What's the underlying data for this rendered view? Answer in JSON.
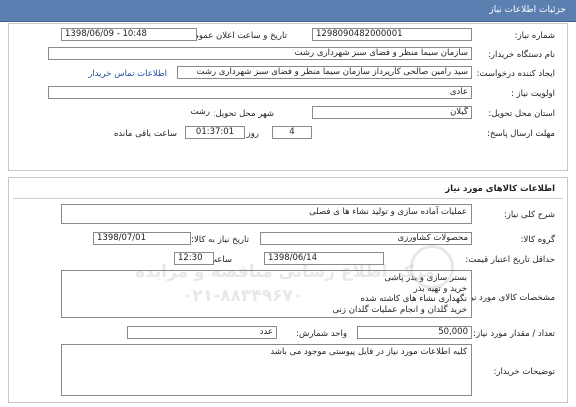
{
  "header": {
    "title": "جزئیات اطلاعات نیاز"
  },
  "info": {
    "need_number_label": "شماره نیاز:",
    "need_number": "1298090482000001",
    "announce_label": "تاریخ و ساعت اعلان عمومی:",
    "announce_value": "1398/06/09 - 10:48",
    "buyer_org_label": "نام دستگاه خریدار:",
    "buyer_org": "سازمان سیما منظر و فضای سبز شهرداری رشت",
    "requester_label": "ایجاد کننده درخواست:",
    "requester": "سید رامین صالحی کارپرداز سازمان سیما منظر و فضای سبز شهرداری رشت",
    "contact_link": "اطلاعات تماس خریدار",
    "priority_label": "اولویت نیاز :",
    "priority": "عادی",
    "province_label": "استان محل تحویل:",
    "province": "گیلان",
    "city_label": "شهر محل تحویل:",
    "city": "رشت",
    "deadline_label": "مهلت ارسال پاسخ:",
    "days": "4",
    "days_unit": "روز و",
    "time_left": "01:37:01",
    "time_left_label": "ساعت باقی مانده"
  },
  "goods": {
    "section_title": "اطلاعات کالاهای مورد نیاز",
    "summary_label": "شرح کلی نیاز:",
    "summary": "عملیات آماده سازی و تولید نشاء ها ی فصلی",
    "group_label": "گروه کالا:",
    "group": "محصولات کشاورزی",
    "need_date_label": "تاریخ نیاز به کالا:",
    "need_date": "1398/07/01",
    "validity_label": "حداقل تاریخ اعتبار قیمت:",
    "validity_date": "1398/06/14",
    "hour_label": "ساعت :",
    "hour": "12:30",
    "specs_label": "مشخصات کالای مورد نیاز:",
    "specs": [
      "بستر سازی و بذر پاشی",
      "خرید و تهیه بذر",
      "نگهداری نشاء های کاشته شده",
      "خرید گلدان و انجام عملیات گلدان زنی"
    ],
    "qty_label": "تعداد / مقدار مورد نیاز:",
    "qty": "50,000",
    "unit_label": "واحد شمارش:",
    "unit": "عدد",
    "notes_label": "توضیحات خریدار:",
    "notes": "کلیه اطلاعات مورد نیاز در فایل پیوستی موجود می باشد"
  },
  "watermark": {
    "line1": "مرکز اطلاع رسانی مناقصه و مزایده",
    "line2": "۰۲۱-۸۸۳۴۹۶۷۰"
  }
}
